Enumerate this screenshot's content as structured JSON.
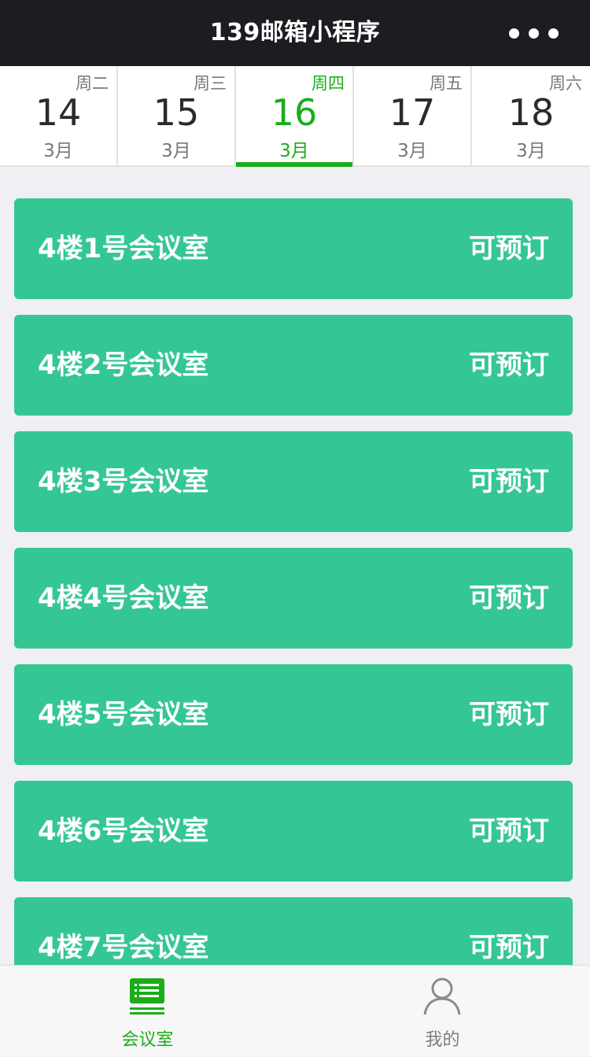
{
  "navbar": {
    "title": "139邮箱小程序",
    "more_icon": "more-dots-icon"
  },
  "dates": [
    {
      "weekday": "周二",
      "day": "14",
      "month": "3月",
      "active": false
    },
    {
      "weekday": "周三",
      "day": "15",
      "month": "3月",
      "active": false
    },
    {
      "weekday": "周四",
      "day": "16",
      "month": "3月",
      "active": true
    },
    {
      "weekday": "周五",
      "day": "17",
      "month": "3月",
      "active": false
    },
    {
      "weekday": "周六",
      "day": "18",
      "month": "3月",
      "active": false
    }
  ],
  "rooms": [
    {
      "name": "4楼1号会议室",
      "status": "可预订"
    },
    {
      "name": "4楼2号会议室",
      "status": "可预订"
    },
    {
      "name": "4楼3号会议室",
      "status": "可预订"
    },
    {
      "name": "4楼4号会议室",
      "status": "可预订"
    },
    {
      "name": "4楼5号会议室",
      "status": "可预订"
    },
    {
      "name": "4楼6号会议室",
      "status": "可预订"
    },
    {
      "name": "4楼7号会议室",
      "status": "可预订"
    }
  ],
  "tabbar": {
    "items": [
      {
        "label": "会议室",
        "icon": "list-icon",
        "active": true
      },
      {
        "label": "我的",
        "icon": "user-icon",
        "active": false
      }
    ]
  },
  "colors": {
    "accent": "#1aad19",
    "card": "#35c793",
    "navbar": "#1c1d20",
    "background": "#efeff4"
  }
}
